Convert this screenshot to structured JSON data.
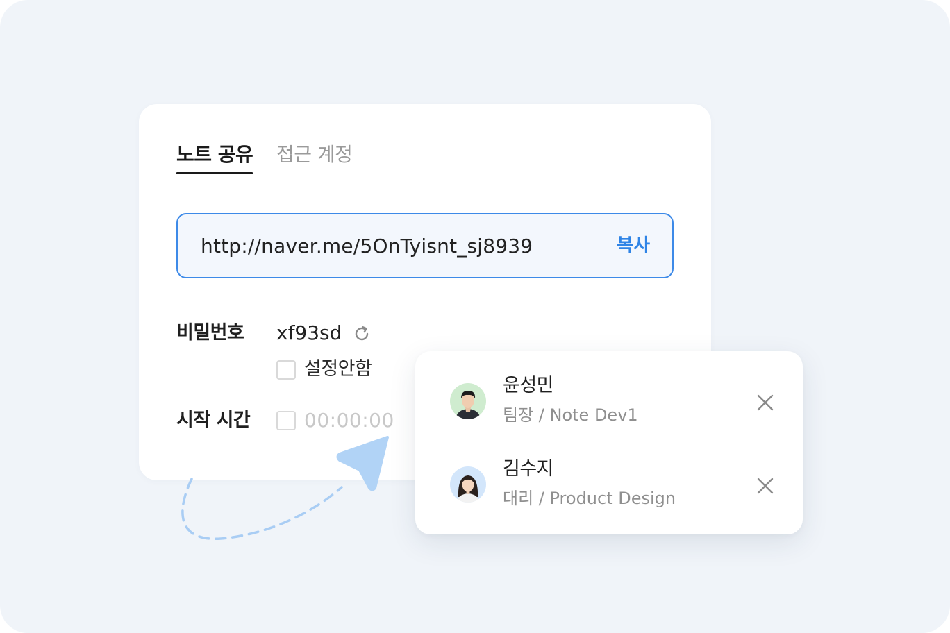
{
  "tabs": [
    {
      "label": "노트 공유",
      "active": true
    },
    {
      "label": "접근 계정",
      "active": false
    }
  ],
  "share": {
    "url": "http://naver.me/5OnTyisnt_sj8939",
    "copy_label": "복사"
  },
  "password": {
    "label": "비밀번호",
    "value": "xf93sd",
    "no_password_label": "설정안함"
  },
  "start_time": {
    "label": "시작 시간",
    "value": "00:00:00"
  },
  "members": [
    {
      "name": "윤성민",
      "role": "팀장 / Note Dev1"
    },
    {
      "name": "김수지",
      "role": "대리 / Product Design"
    }
  ],
  "colors": {
    "accent": "#2f84e6",
    "page_bg": "#f0f4f9",
    "avatar_bg_1": "#cfeccf",
    "avatar_bg_2": "#d3e6fb"
  },
  "icons": {
    "refresh": "refresh-icon",
    "remove": "close-icon",
    "send": "paper-plane-icon"
  }
}
